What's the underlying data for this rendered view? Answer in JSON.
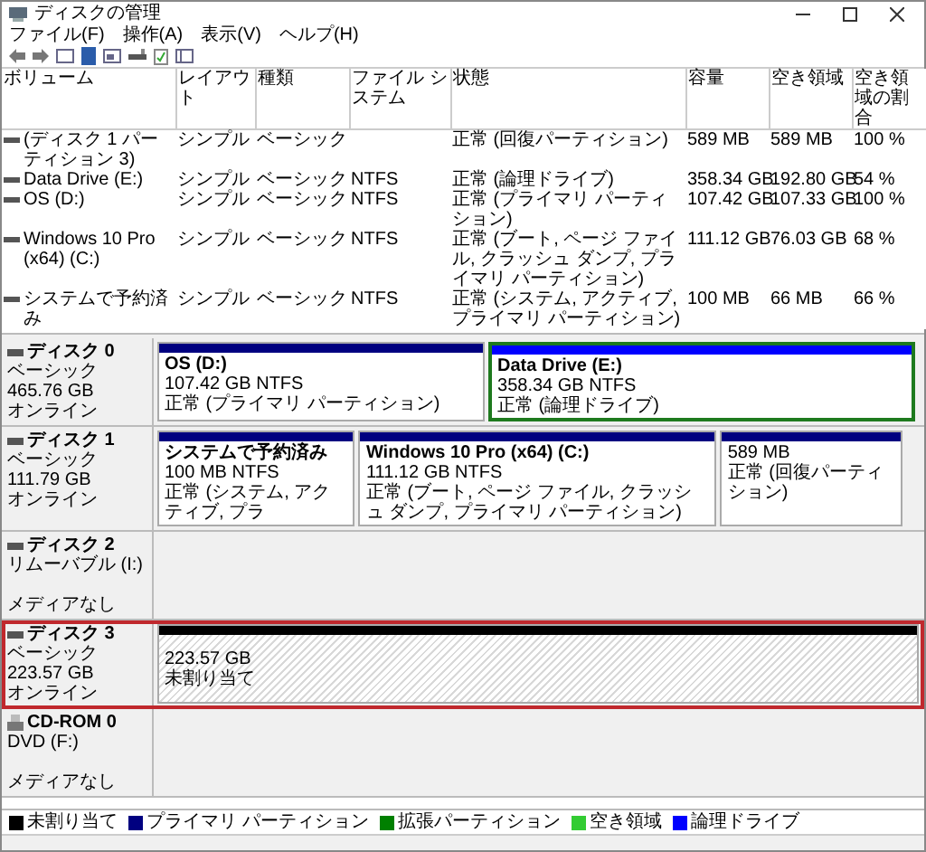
{
  "window": {
    "title": "ディスクの管理"
  },
  "menu": [
    "ファイル(F)",
    "操作(A)",
    "表示(V)",
    "ヘルプ(H)"
  ],
  "volumes": {
    "columns": [
      "ボリューム",
      "レイアウト",
      "種類",
      "ファイル システム",
      "状態",
      "容量",
      "空き領域",
      "空き領域の割合"
    ],
    "rows": [
      [
        "(ディスク 1 パーティション 3)",
        "シンプル",
        "ベーシック",
        "",
        "正常 (回復パーティション)",
        "589 MB",
        "589 MB",
        "100 %"
      ],
      [
        "Data Drive (E:)",
        "シンプル",
        "ベーシック",
        "NTFS",
        "正常 (論理ドライブ)",
        "358.34 GB",
        "192.80 GB",
        "54 %"
      ],
      [
        "OS (D:)",
        "シンプル",
        "ベーシック",
        "NTFS",
        "正常 (プライマリ パーティション)",
        "107.42 GB",
        "107.33 GB",
        "100 %"
      ],
      [
        "Windows 10 Pro (x64) (C:)",
        "シンプル",
        "ベーシック",
        "NTFS",
        "正常 (ブート, ページ ファイル, クラッシュ ダンプ, プライマリ パーティション)",
        "111.12 GB",
        "76.03 GB",
        "68 %"
      ],
      [
        "システムで予約済み",
        "シンプル",
        "ベーシック",
        "NTFS",
        "正常 (システム, アクティブ, プライマリ パーティション)",
        "100 MB",
        "66 MB",
        "66 %"
      ]
    ]
  },
  "disks": [
    {
      "kind": "disk",
      "name": "ディスク 0",
      "info": [
        "ベーシック",
        "465.76 GB",
        "オンライン"
      ],
      "highlighted": false,
      "partitions": [
        {
          "kind": "primary",
          "name": "OS  (D:)",
          "size": "107.42 GB NTFS",
          "status": "正常 (プライマリ パーティション)",
          "selected": false
        },
        {
          "kind": "logical",
          "name": "Data Drive  (E:)",
          "size": "358.34 GB NTFS",
          "status": "正常 (論理ドライブ)",
          "selected": true
        }
      ]
    },
    {
      "kind": "disk",
      "name": "ディスク 1",
      "info": [
        "ベーシック",
        "111.79 GB",
        "オンライン"
      ],
      "highlighted": false,
      "partitions": [
        {
          "kind": "primary",
          "name": "システムで予約済み",
          "size": "100 MB NTFS",
          "status": "正常 (システム, アクティブ, プラ",
          "selected": false
        },
        {
          "kind": "primary",
          "name": "Windows 10 Pro (x64)  (C:)",
          "size": "111.12 GB NTFS",
          "status": "正常 (ブート, ページ ファイル, クラッシュ ダンプ, プライマリ パーティション)",
          "selected": false
        },
        {
          "kind": "primary",
          "size": "589 MB",
          "status": "正常 (回復パーティション)",
          "selected": false
        }
      ]
    },
    {
      "kind": "disk",
      "name": "ディスク 2",
      "info": [
        "リムーバブル (I:)",
        "メディアなし"
      ],
      "highlighted": false
    },
    {
      "kind": "disk",
      "name": "ディスク 3",
      "info": [
        "ベーシック",
        "223.57 GB",
        "オンライン"
      ],
      "highlighted": true,
      "partitions": [
        {
          "kind": "unallocated",
          "size": "223.57 GB",
          "status": "未割り当て",
          "selected": false
        }
      ]
    },
    {
      "kind": "cdrom",
      "name": "CD-ROM 0",
      "info": [
        "DVD (F:)",
        "メディアなし"
      ],
      "highlighted": false
    }
  ],
  "legend": [
    {
      "label": "未割り当て",
      "color": "#000000"
    },
    {
      "label": "プライマリ パーティション",
      "color": "#000080"
    },
    {
      "label": "拡張パーティション",
      "color": "#008000"
    },
    {
      "label": "空き領域",
      "color": "#33cc33"
    },
    {
      "label": "論理ドライブ",
      "color": "#0000ff"
    }
  ]
}
